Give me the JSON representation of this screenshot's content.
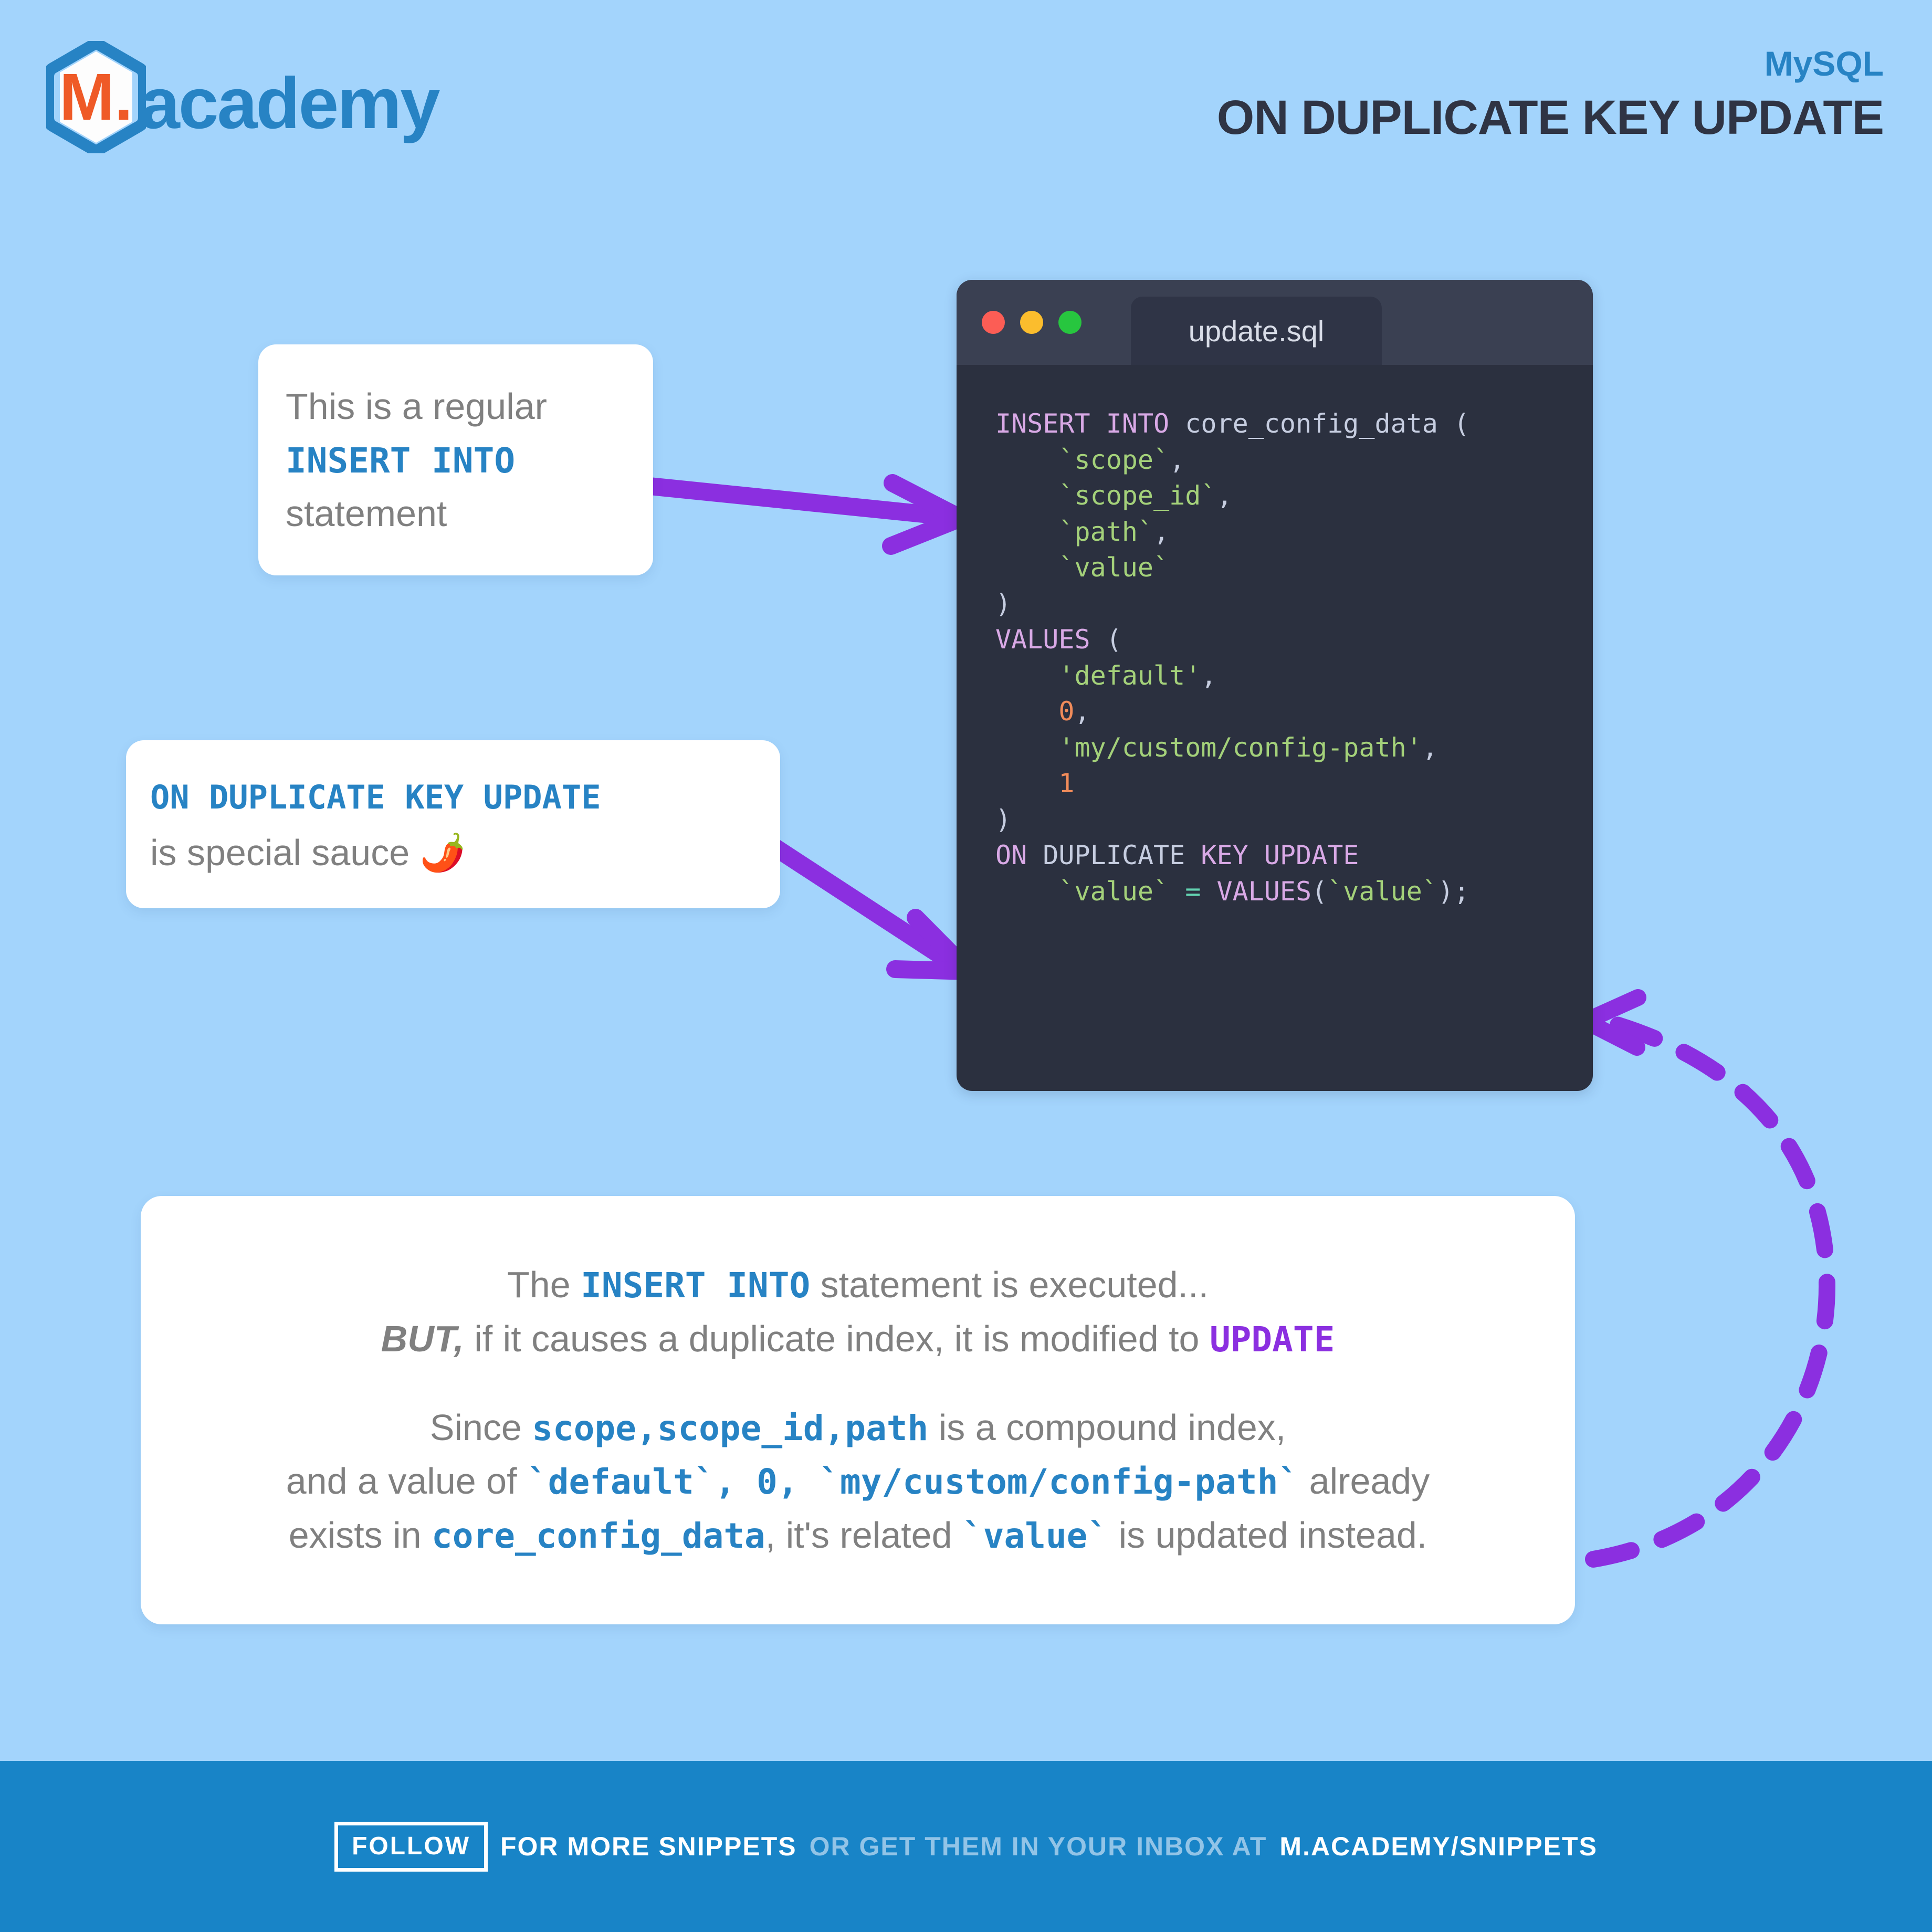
{
  "header": {
    "logo_letter": "M.",
    "logo_word": "academy",
    "subtitle": "MySQL",
    "title": "ON DUPLICATE KEY UPDATE",
    "brand_blue": "#2783c4",
    "title_dark": "#2f3444"
  },
  "code_window": {
    "tab_label": "update.sql",
    "lights": [
      "red",
      "yellow",
      "green"
    ],
    "background": "#2b303f",
    "titlebar": "#3a4052",
    "lines": [
      {
        "id": 1,
        "text": "INSERT INTO core_config_data ("
      },
      {
        "id": 2,
        "text": "    `scope`,"
      },
      {
        "id": 3,
        "text": "    `scope_id`,"
      },
      {
        "id": 4,
        "text": "    `path`,"
      },
      {
        "id": 5,
        "text": "    `value`"
      },
      {
        "id": 6,
        "text": ")"
      },
      {
        "id": 7,
        "text": "VALUES ("
      },
      {
        "id": 8,
        "text": "    'default',"
      },
      {
        "id": 9,
        "text": "    0,"
      },
      {
        "id": 10,
        "text": "    'my/custom/config-path',"
      },
      {
        "id": 11,
        "text": "    1"
      },
      {
        "id": 12,
        "text": ")"
      },
      {
        "id": 13,
        "text": "ON DUPLICATE KEY UPDATE"
      },
      {
        "id": 14,
        "text": "    `value` = VALUES(`value`);"
      }
    ],
    "tokens": {
      "l1_kw_insert": "INSERT",
      "l1_kw_into": "INTO",
      "l1_table": "core_config_data",
      "l1_paren": "(",
      "l2_col": "`scope`",
      "l2_comma": ",",
      "l3_col": "`scope_id`",
      "l3_comma": ",",
      "l4_col": "`path`",
      "l4_comma": ",",
      "l5_col": "`value`",
      "l6_paren": ")",
      "l7_kw": "VALUES",
      "l7_paren": "(",
      "l8_str": "'default'",
      "l8_comma": ",",
      "l9_num": "0",
      "l9_comma": ",",
      "l10_str": "'my/custom/config-path'",
      "l10_comma": ",",
      "l11_num": "1",
      "l12_paren": ")",
      "l13_on": "ON",
      "l13_duplicate": "DUPLICATE",
      "l13_key": "KEY",
      "l13_update": "UPDATE",
      "l14_col": "`value`",
      "l14_eq": "=",
      "l14_fn": "VALUES",
      "l14_open": "(",
      "l14_arg": "`value`",
      "l14_close": ");"
    }
  },
  "callout_insert": {
    "line1": "This is a regular",
    "code": "INSERT INTO",
    "line3": "statement"
  },
  "callout_odku": {
    "code": "ON DUPLICATE KEY UPDATE",
    "line2": "is special sauce ",
    "emoji": "🌶️"
  },
  "explain": {
    "p1_a": "The ",
    "p1_code": "INSERT INTO",
    "p1_b": " statement is executed...",
    "p2_a": "BUT,",
    "p2_b": " if it causes a duplicate index, it is modified to ",
    "p2_code": "UPDATE",
    "p3_a": "Since ",
    "p3_code": "scope,scope_id,path",
    "p3_b": " is a compound index,",
    "p4_a": "and a value of ",
    "p4_code1": "`default`, 0, `my/custom/config-path`",
    "p4_b": " already",
    "p5_a": "exists in ",
    "p5_code1": "core_config_data",
    "p5_b": ", it's related ",
    "p5_code2": "`value`",
    "p5_c": " is updated instead."
  },
  "footer": {
    "badge": "FOLLOW",
    "strong1": "FOR MORE SNIPPETS",
    "dim": "OR GET THEM IN YOUR INBOX AT",
    "strong2": "M.ACADEMY/SNIPPETS",
    "background": "#1884c7"
  },
  "colors": {
    "page_background": "#a3d4fc",
    "arrow_purple": "#8b2fe0",
    "accent_blue": "#2783c4",
    "logo_orange": "#ef5a27",
    "text_gray": "#808080"
  },
  "arrows": [
    {
      "id": "arrow-insert",
      "style": "solid",
      "from": "callout-insert",
      "to": "code-line-1"
    },
    {
      "id": "arrow-odku",
      "style": "solid",
      "from": "callout-odku",
      "to": "code-line-13"
    },
    {
      "id": "arrow-explain",
      "style": "dashed",
      "from": "explain-box",
      "to": "code-line-14"
    }
  ]
}
